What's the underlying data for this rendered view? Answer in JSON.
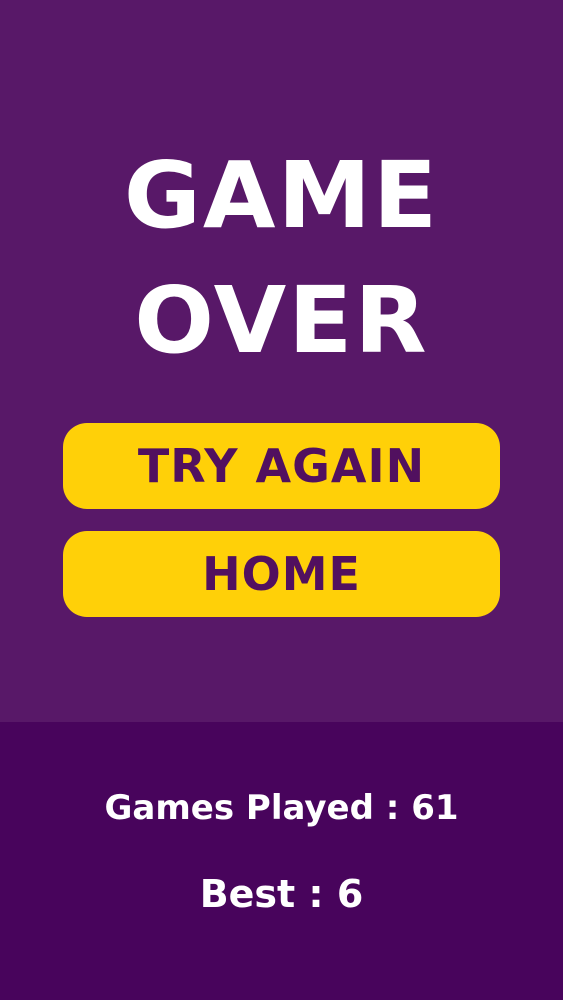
{
  "title": {
    "line1": "GAME",
    "line2": "OVER"
  },
  "buttons": {
    "try_again": "TRY AGAIN",
    "home": "HOME"
  },
  "stats": {
    "games_played": "Games Played : 61",
    "best": "Best : 6"
  },
  "colors": {
    "background_top": "#581868",
    "background_bottom": "#48045C",
    "button": "#FFD008",
    "button_text": "#51105F",
    "title_text": "#FFFFFF"
  }
}
